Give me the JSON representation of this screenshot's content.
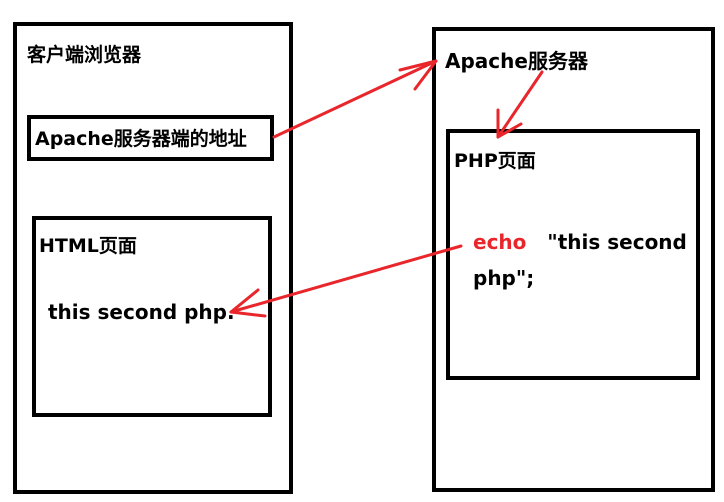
{
  "client": {
    "title": "客户端浏览器",
    "address_box": "Apache服务器端的地址",
    "html_page_title": "HTML页面",
    "html_output": "this second php."
  },
  "server": {
    "title": "Apache服务器",
    "php_page_title": "PHP页面",
    "code_keyword": "echo",
    "code_string_line1": "\"this second",
    "code_string_line2": "php\";"
  },
  "colors": {
    "arrow": "#e8262b",
    "keyword": "#e8262b",
    "border": "#000000"
  }
}
